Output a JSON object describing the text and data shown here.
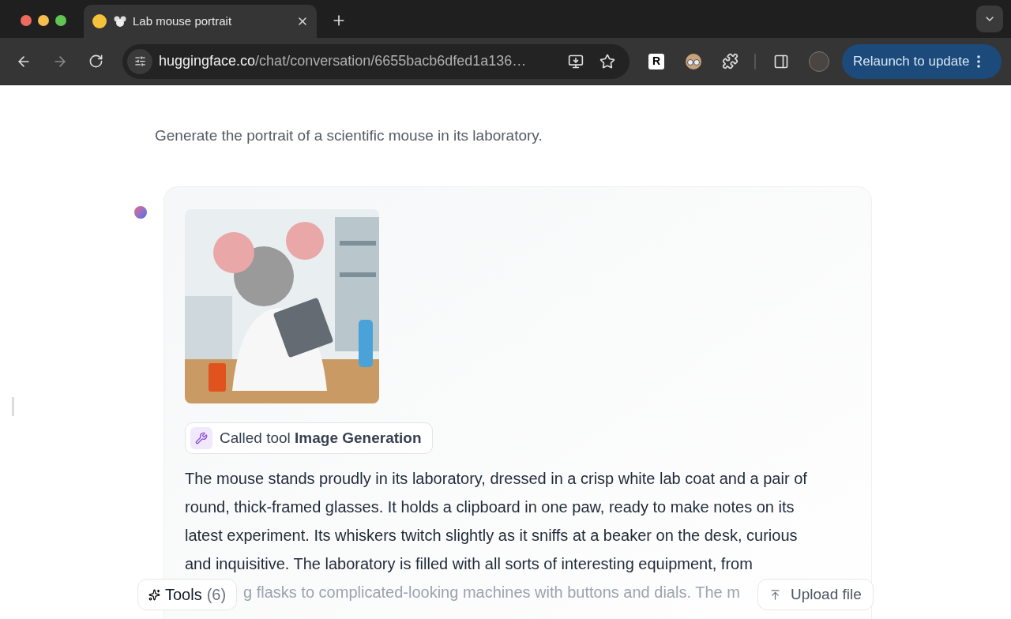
{
  "browser": {
    "tabs": [
      {
        "title": "Lab mouse portrait",
        "selected": true
      }
    ],
    "url_host": "huggingface.co",
    "url_path": "/chat/conversation/6655bacb6dfed1a136…",
    "extension_letter": "R",
    "relaunch_label": "Relaunch to update"
  },
  "chat": {
    "prompt": "Generate the portrait of a scientific mouse in its laboratory.",
    "response": {
      "tool_call": "Called tool **Image Generation**",
      "text": "The mouse stands proudly in its laboratory, dressed in a crisp white lab coat and a pair of round, thick-framed glasses. It holds a clipboard in one paw, ready to make notes on its latest experiment. Its whiskers twitch slightly as it sniffs at a beaker on the desk, curious and inquisitive. The laboratory is filled with all sorts of interesting equipment, from",
      "partial_line": "g flasks to complicated-looking machines with buttons and dials. The m"
    }
  },
  "input_bar": {
    "tools_label": "Tools",
    "tools_count": "(6)",
    "upload_label": "Upload file"
  }
}
